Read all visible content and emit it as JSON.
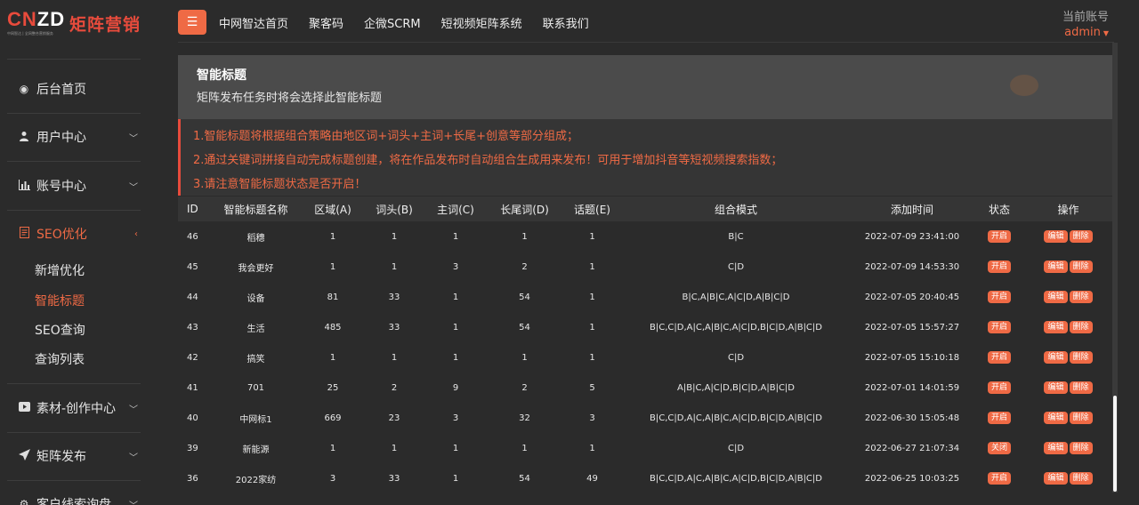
{
  "logo": {
    "mark_left": "CN",
    "mark_right": "ZD",
    "subtitle": "中网智达 | 全网整合营销服务",
    "name": "矩阵营销"
  },
  "sidebar": {
    "items": [
      {
        "label": "后台首页",
        "icon": "target-icon"
      },
      {
        "label": "用户中心",
        "icon": "user-icon"
      },
      {
        "label": "账号中心",
        "icon": "bar-chart-icon"
      },
      {
        "label": "SEO优化",
        "icon": "document-icon"
      },
      {
        "label": "素材-创作中心",
        "icon": "video-icon"
      },
      {
        "label": "矩阵发布",
        "icon": "send-icon"
      },
      {
        "label": "客户线索询盘",
        "icon": "gear-icon"
      }
    ],
    "seo_subitems": [
      "新增优化",
      "智能标题",
      "SEO查询",
      "查询列表"
    ]
  },
  "topbar": {
    "nav": [
      "中网智达首页",
      "聚客码",
      "企微SCRM",
      "短视频矩阵系统",
      "联系我们"
    ],
    "account_label": "当前账号",
    "account_user": "admin"
  },
  "banner": {
    "title": "智能标题",
    "desc": "矩阵发布任务时将会选择此智能标题"
  },
  "tips": [
    "1.智能标题将根据组合策略由地区词+词头+主词+长尾+创意等部分组成；",
    "2.通过关键词拼接自动完成标题创建，将在作品发布时自动组合生成用来发布！可用于增加抖音等短视频搜索指数；",
    "3.请注意智能标题状态是否开启！"
  ],
  "table": {
    "headers": [
      "ID",
      "智能标题名称",
      "区域(A)",
      "词头(B)",
      "主词(C)",
      "长尾词(D)",
      "话题(E)",
      "组合模式",
      "添加时间",
      "状态",
      "操作"
    ],
    "edit_label": "编辑",
    "delete_label": "删除",
    "rows": [
      {
        "id": "46",
        "name": "稻穗",
        "a": "1",
        "b": "1",
        "c": "1",
        "d": "1",
        "e": "1",
        "mode": "B|C",
        "time": "2022-07-09 23:41:00",
        "status": "开启"
      },
      {
        "id": "45",
        "name": "我会更好",
        "a": "1",
        "b": "1",
        "c": "3",
        "d": "2",
        "e": "1",
        "mode": "C|D",
        "time": "2022-07-09 14:53:30",
        "status": "开启"
      },
      {
        "id": "44",
        "name": "设备",
        "a": "81",
        "b": "33",
        "c": "1",
        "d": "54",
        "e": "1",
        "mode": "B|C,A|B|C,A|C|D,A|B|C|D",
        "time": "2022-07-05 20:40:45",
        "status": "开启"
      },
      {
        "id": "43",
        "name": "生活",
        "a": "485",
        "b": "33",
        "c": "1",
        "d": "54",
        "e": "1",
        "mode": "B|C,C|D,A|C,A|B|C,A|C|D,B|C|D,A|B|C|D",
        "time": "2022-07-05 15:57:27",
        "status": "开启"
      },
      {
        "id": "42",
        "name": "搞笑",
        "a": "1",
        "b": "1",
        "c": "1",
        "d": "1",
        "e": "1",
        "mode": "C|D",
        "time": "2022-07-05 15:10:18",
        "status": "开启"
      },
      {
        "id": "41",
        "name": "701",
        "a": "25",
        "b": "2",
        "c": "9",
        "d": "2",
        "e": "5",
        "mode": "A|B|C,A|C|D,B|C|D,A|B|C|D",
        "time": "2022-07-01 14:01:59",
        "status": "开启"
      },
      {
        "id": "40",
        "name": "中网标1",
        "a": "669",
        "b": "23",
        "c": "3",
        "d": "32",
        "e": "3",
        "mode": "B|C,C|D,A|C,A|B|C,A|C|D,B|C|D,A|B|C|D",
        "time": "2022-06-30 15:05:48",
        "status": "开启"
      },
      {
        "id": "39",
        "name": "新能源",
        "a": "1",
        "b": "1",
        "c": "1",
        "d": "1",
        "e": "1",
        "mode": "C|D",
        "time": "2022-06-27 21:07:34",
        "status": "关闭"
      },
      {
        "id": "36",
        "name": "2022家纺",
        "a": "3",
        "b": "33",
        "c": "1",
        "d": "54",
        "e": "49",
        "mode": "B|C,C|D,A|C,A|B|C,A|C|D,B|C|D,A|B|C|D",
        "time": "2022-06-25 10:03:25",
        "status": "开启"
      }
    ]
  },
  "colors": {
    "accent": "#ef6a45",
    "background": "#2b2b2b",
    "panel": "#4b4b4b"
  }
}
